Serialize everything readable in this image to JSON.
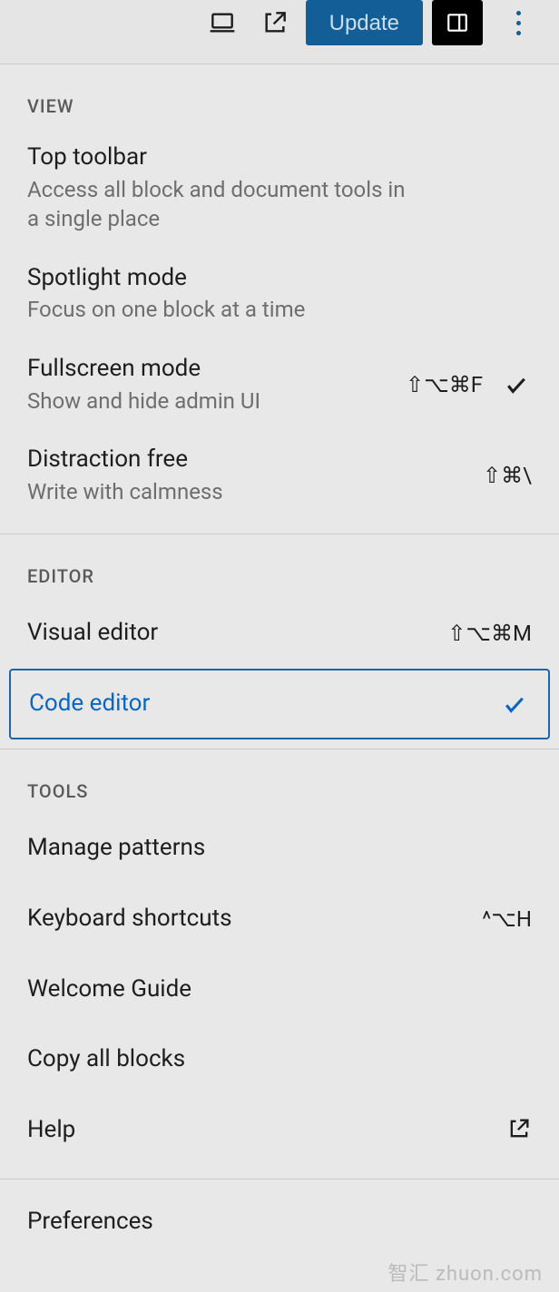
{
  "toolbar": {
    "update_label": "Update"
  },
  "sections": {
    "view": {
      "label": "VIEW",
      "items": {
        "top_toolbar": {
          "title": "Top toolbar",
          "desc": "Access all block and document tools in a single place"
        },
        "spotlight": {
          "title": "Spotlight mode",
          "desc": "Focus on one block at a time"
        },
        "fullscreen": {
          "title": "Fullscreen mode",
          "desc": "Show and hide admin UI",
          "shortcut": "⇧⌥⌘F"
        },
        "distraction": {
          "title": "Distraction free",
          "desc": "Write with calmness",
          "shortcut": "⇧⌘\\"
        }
      }
    },
    "editor": {
      "label": "EDITOR",
      "items": {
        "visual": {
          "title": "Visual editor",
          "shortcut": "⇧⌥⌘M"
        },
        "code": {
          "title": "Code editor"
        }
      }
    },
    "tools": {
      "label": "TOOLS",
      "items": {
        "manage_patterns": {
          "title": "Manage patterns"
        },
        "keyboard_shortcuts": {
          "title": "Keyboard shortcuts",
          "shortcut": "^⌥H"
        },
        "welcome_guide": {
          "title": "Welcome Guide"
        },
        "copy_all": {
          "title": "Copy all blocks"
        },
        "help": {
          "title": "Help"
        }
      }
    },
    "preferences": {
      "title": "Preferences"
    }
  },
  "watermark": {
    "cn": "智汇",
    "en": "zhuon.com"
  }
}
